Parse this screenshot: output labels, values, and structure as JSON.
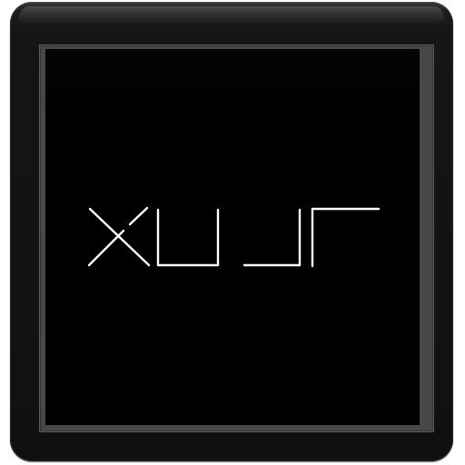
{
  "watch_face": {
    "logo_text": "XULI",
    "logo_color": "#ffffff",
    "screen_color": "#000000",
    "frame_color": "#171717"
  }
}
